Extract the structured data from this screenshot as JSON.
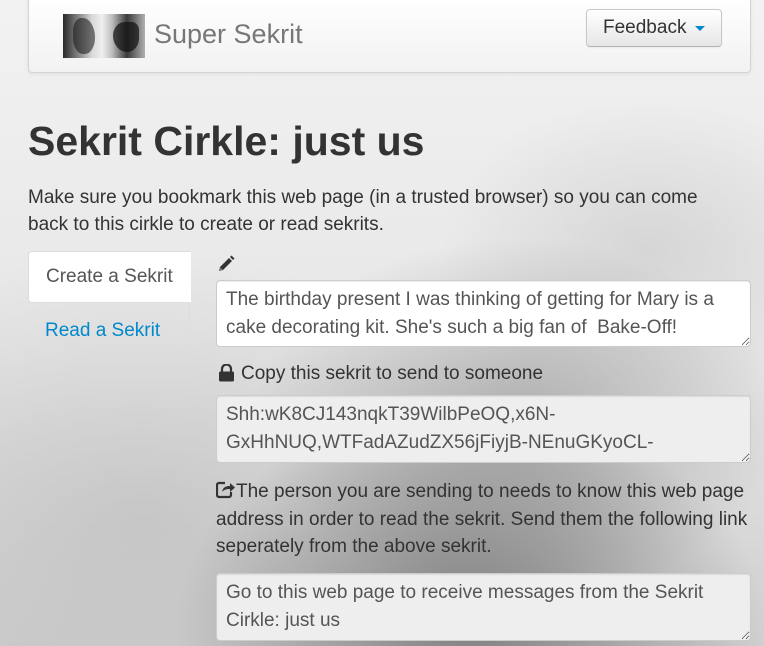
{
  "navbar": {
    "brand": "Super Sekrit",
    "feedback_label": "Feedback"
  },
  "page": {
    "title": "Sekrit Cirkle: just us",
    "intro": "Make sure you bookmark this web page (in a trusted browser) so you can come back to this cirkle to create or read sekrits."
  },
  "tabs": [
    {
      "label": "Create a Sekrit",
      "active": true
    },
    {
      "label": "Read a Sekrit",
      "active": false
    }
  ],
  "create": {
    "message_value": "The birthday present I was thinking of getting for Mary is a cake decorating kit. She's such a big fan of  Bake-Off!",
    "copy_label": "Copy this sekrit to send to someone",
    "code_value": "Shh:wK8CJ143nqkT39WilbPeOQ,x6N-GxHhNUQ,WTFadAZudZX56jFiyjB-NEnuGKyoCL-",
    "share_instructions": "The person you are sending to needs to know this web page address in order to read the sekrit. Send them the following link seperately from the above sekrit.",
    "link_value": "Go to this web page to receive messages from the Sekrit Cirkle: just us"
  },
  "icons": {
    "edit": "pencil-icon",
    "lock": "lock-icon",
    "share": "share-icon"
  },
  "colors": {
    "link": "#0088cc",
    "text": "#333333",
    "readonly_field": "#eeeeee"
  }
}
